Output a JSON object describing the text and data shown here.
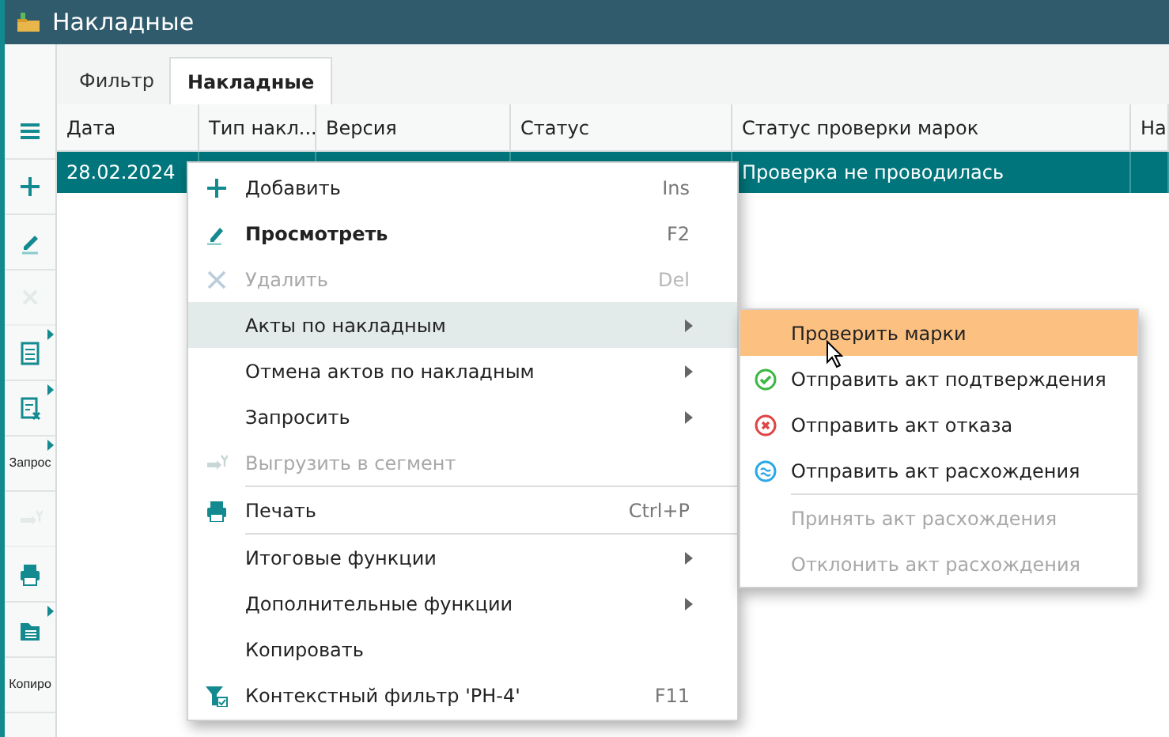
{
  "window": {
    "title": "Накладные"
  },
  "tabs": [
    {
      "label": "Фильтр",
      "selected": false
    },
    {
      "label": "Накладные",
      "selected": true
    }
  ],
  "toolbar": [
    {
      "kind": "icon",
      "disabled": false,
      "has_menu": false
    },
    {
      "kind": "icon",
      "disabled": false,
      "has_menu": false
    },
    {
      "kind": "icon",
      "disabled": false,
      "has_menu": false
    },
    {
      "kind": "icon",
      "disabled": true,
      "has_menu": false
    },
    {
      "kind": "icon",
      "disabled": false,
      "has_menu": true
    },
    {
      "kind": "icon",
      "disabled": false,
      "has_menu": true
    },
    {
      "kind": "label",
      "label": "Запрос",
      "disabled": false,
      "has_menu": true
    },
    {
      "kind": "icon",
      "disabled": true,
      "has_menu": false
    },
    {
      "kind": "icon",
      "disabled": false,
      "has_menu": false
    },
    {
      "kind": "icon",
      "disabled": false,
      "has_menu": true
    },
    {
      "kind": "label",
      "label": "Копиро",
      "disabled": false,
      "has_menu": false
    }
  ],
  "table": {
    "columns": [
      "Дата",
      "Тип накл...",
      "Версия",
      "Статус",
      "Статус проверки марок",
      "На"
    ],
    "rows": [
      {
        "selected": true,
        "cells": [
          "28.02.2024",
          "",
          "",
          "",
          "Проверка не проводилась",
          ""
        ]
      }
    ]
  },
  "context_menu": {
    "items": [
      {
        "kind": "item",
        "label": "Добавить",
        "shortcut": "Ins",
        "disabled": false,
        "bold": false,
        "submenu": false,
        "selected": false
      },
      {
        "kind": "item",
        "label": "Просмотреть",
        "shortcut": "F2",
        "disabled": false,
        "bold": true,
        "submenu": false,
        "selected": false
      },
      {
        "kind": "item",
        "label": "Удалить",
        "shortcut": "Del",
        "disabled": true,
        "bold": false,
        "submenu": false,
        "selected": false
      },
      {
        "kind": "item",
        "label": "Акты по накладным",
        "disabled": false,
        "bold": false,
        "submenu": true,
        "selected": true
      },
      {
        "kind": "item",
        "label": "Отмена актов по накладным",
        "disabled": false,
        "bold": false,
        "submenu": true,
        "selected": false
      },
      {
        "kind": "item",
        "label": "Запросить",
        "disabled": false,
        "bold": false,
        "submenu": true,
        "selected": false
      },
      {
        "kind": "item",
        "label": "Выгрузить в сегмент",
        "disabled": true,
        "bold": false,
        "submenu": false,
        "selected": false
      },
      {
        "kind": "separator"
      },
      {
        "kind": "item",
        "label": "Печать",
        "shortcut": "Ctrl+P",
        "disabled": false,
        "bold": false,
        "submenu": false,
        "selected": false
      },
      {
        "kind": "separator"
      },
      {
        "kind": "item",
        "label": "Итоговые функции",
        "disabled": false,
        "bold": false,
        "submenu": true,
        "selected": false
      },
      {
        "kind": "item",
        "label": "Дополнительные функции",
        "disabled": false,
        "bold": false,
        "submenu": true,
        "selected": false
      },
      {
        "kind": "item",
        "label": "Копировать",
        "disabled": false,
        "bold": false,
        "submenu": false,
        "selected": false
      },
      {
        "kind": "item",
        "label": "Контекстный фильтр 'РН-4'",
        "shortcut": "F11",
        "disabled": false,
        "bold": false,
        "submenu": false,
        "selected": false
      }
    ]
  },
  "submenu": {
    "items": [
      {
        "kind": "item",
        "label": "Проверить марки",
        "disabled": false,
        "selected": true
      },
      {
        "kind": "item",
        "label": "Отправить акт подтверждения",
        "disabled": false,
        "selected": false
      },
      {
        "kind": "item",
        "label": "Отправить акт отказа",
        "disabled": false,
        "selected": false
      },
      {
        "kind": "item",
        "label": "Отправить акт расхождения",
        "disabled": false,
        "selected": false
      },
      {
        "kind": "separator"
      },
      {
        "kind": "item",
        "label": "Принять акт расхождения",
        "disabled": true,
        "selected": false
      },
      {
        "kind": "item",
        "label": "Отклонить акт расхождения",
        "disabled": true,
        "selected": false
      }
    ]
  }
}
